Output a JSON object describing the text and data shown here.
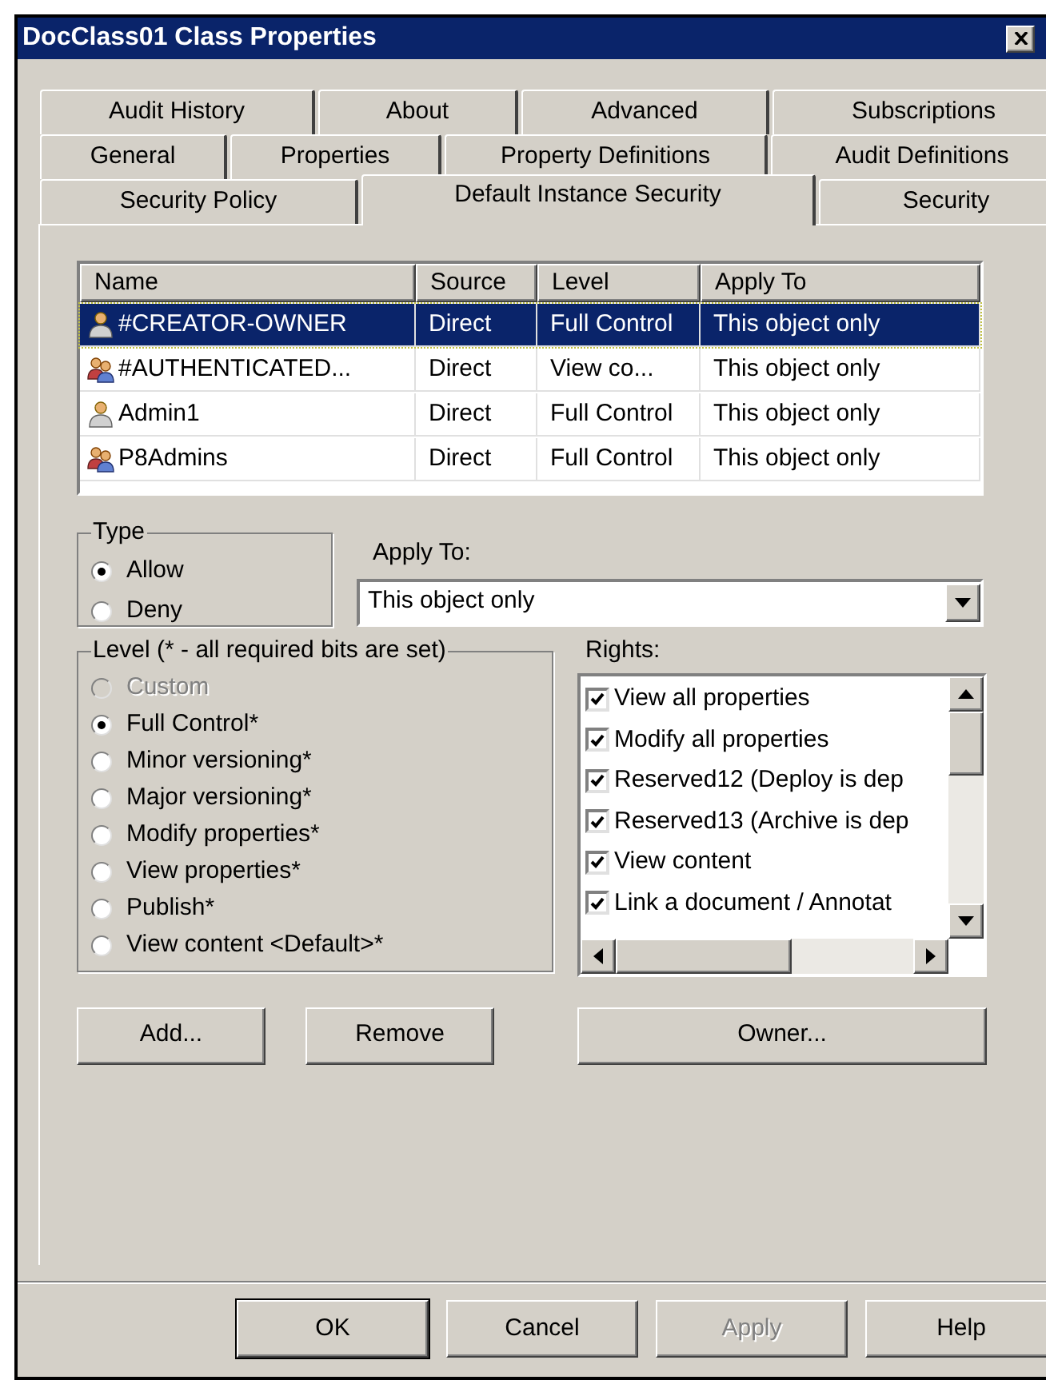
{
  "window": {
    "title": "DocClass01 Class Properties"
  },
  "tab_rows": [
    [
      {
        "label": "Audit History",
        "selected": false
      },
      {
        "label": "About",
        "selected": false
      },
      {
        "label": "Advanced",
        "selected": false
      },
      {
        "label": "Subscriptions",
        "selected": false
      }
    ],
    [
      {
        "label": "General",
        "selected": false
      },
      {
        "label": "Properties",
        "selected": false
      },
      {
        "label": "Property Definitions",
        "selected": false
      },
      {
        "label": "Audit Definitions",
        "selected": false
      }
    ],
    [
      {
        "label": "Security Policy",
        "selected": false
      },
      {
        "label": "Default Instance Security",
        "selected": true
      },
      {
        "label": "Security",
        "selected": false
      }
    ]
  ],
  "table": {
    "columns": [
      "Name",
      "Source",
      "Level",
      "Apply To"
    ],
    "rows": [
      {
        "kind": "user",
        "selected": true,
        "cells": [
          "#CREATOR-OWNER",
          "Direct",
          "Full Control",
          "This object only"
        ]
      },
      {
        "kind": "group",
        "selected": false,
        "cells": [
          "#AUTHENTICATED...",
          "Direct",
          "View co...",
          "This object only"
        ]
      },
      {
        "kind": "user",
        "selected": false,
        "cells": [
          "Admin1",
          "Direct",
          "Full Control",
          "This object only"
        ]
      },
      {
        "kind": "group",
        "selected": false,
        "cells": [
          "P8Admins",
          "Direct",
          "Full Control",
          "This object only"
        ]
      }
    ]
  },
  "type_group": {
    "title": "Type",
    "options": [
      {
        "label": "Allow",
        "selected": true
      },
      {
        "label": "Deny",
        "selected": false
      }
    ]
  },
  "apply_to": {
    "label": "Apply To:",
    "value": "This object only"
  },
  "level_group": {
    "title": "Level (* - all required bits are set)",
    "options": [
      {
        "label": "Custom",
        "selected": false,
        "disabled": true
      },
      {
        "label": "Full Control*",
        "selected": true,
        "disabled": false
      },
      {
        "label": "Minor versioning*",
        "selected": false,
        "disabled": false
      },
      {
        "label": "Major versioning*",
        "selected": false,
        "disabled": false
      },
      {
        "label": "Modify properties*",
        "selected": false,
        "disabled": false
      },
      {
        "label": "View properties*",
        "selected": false,
        "disabled": false
      },
      {
        "label": "Publish*",
        "selected": false,
        "disabled": false
      },
      {
        "label": "View content <Default>*",
        "selected": false,
        "disabled": false
      }
    ]
  },
  "rights": {
    "label": "Rights:",
    "items": [
      {
        "label": "View all properties",
        "checked": true
      },
      {
        "label": "Modify all properties",
        "checked": true
      },
      {
        "label": "Reserved12 (Deploy is dep",
        "checked": true
      },
      {
        "label": "Reserved13 (Archive is dep",
        "checked": true
      },
      {
        "label": "View content",
        "checked": true
      },
      {
        "label": "Link a document / Annotat",
        "checked": true
      }
    ]
  },
  "action_buttons": [
    {
      "label": "Add..."
    },
    {
      "label": "Remove"
    },
    {
      "label": "Owner..."
    }
  ],
  "footer_buttons": [
    {
      "label": "OK",
      "disabled": false,
      "default": true
    },
    {
      "label": "Cancel",
      "disabled": false,
      "default": false
    },
    {
      "label": "Apply",
      "disabled": true,
      "default": false
    },
    {
      "label": "Help",
      "disabled": false,
      "default": false
    }
  ]
}
